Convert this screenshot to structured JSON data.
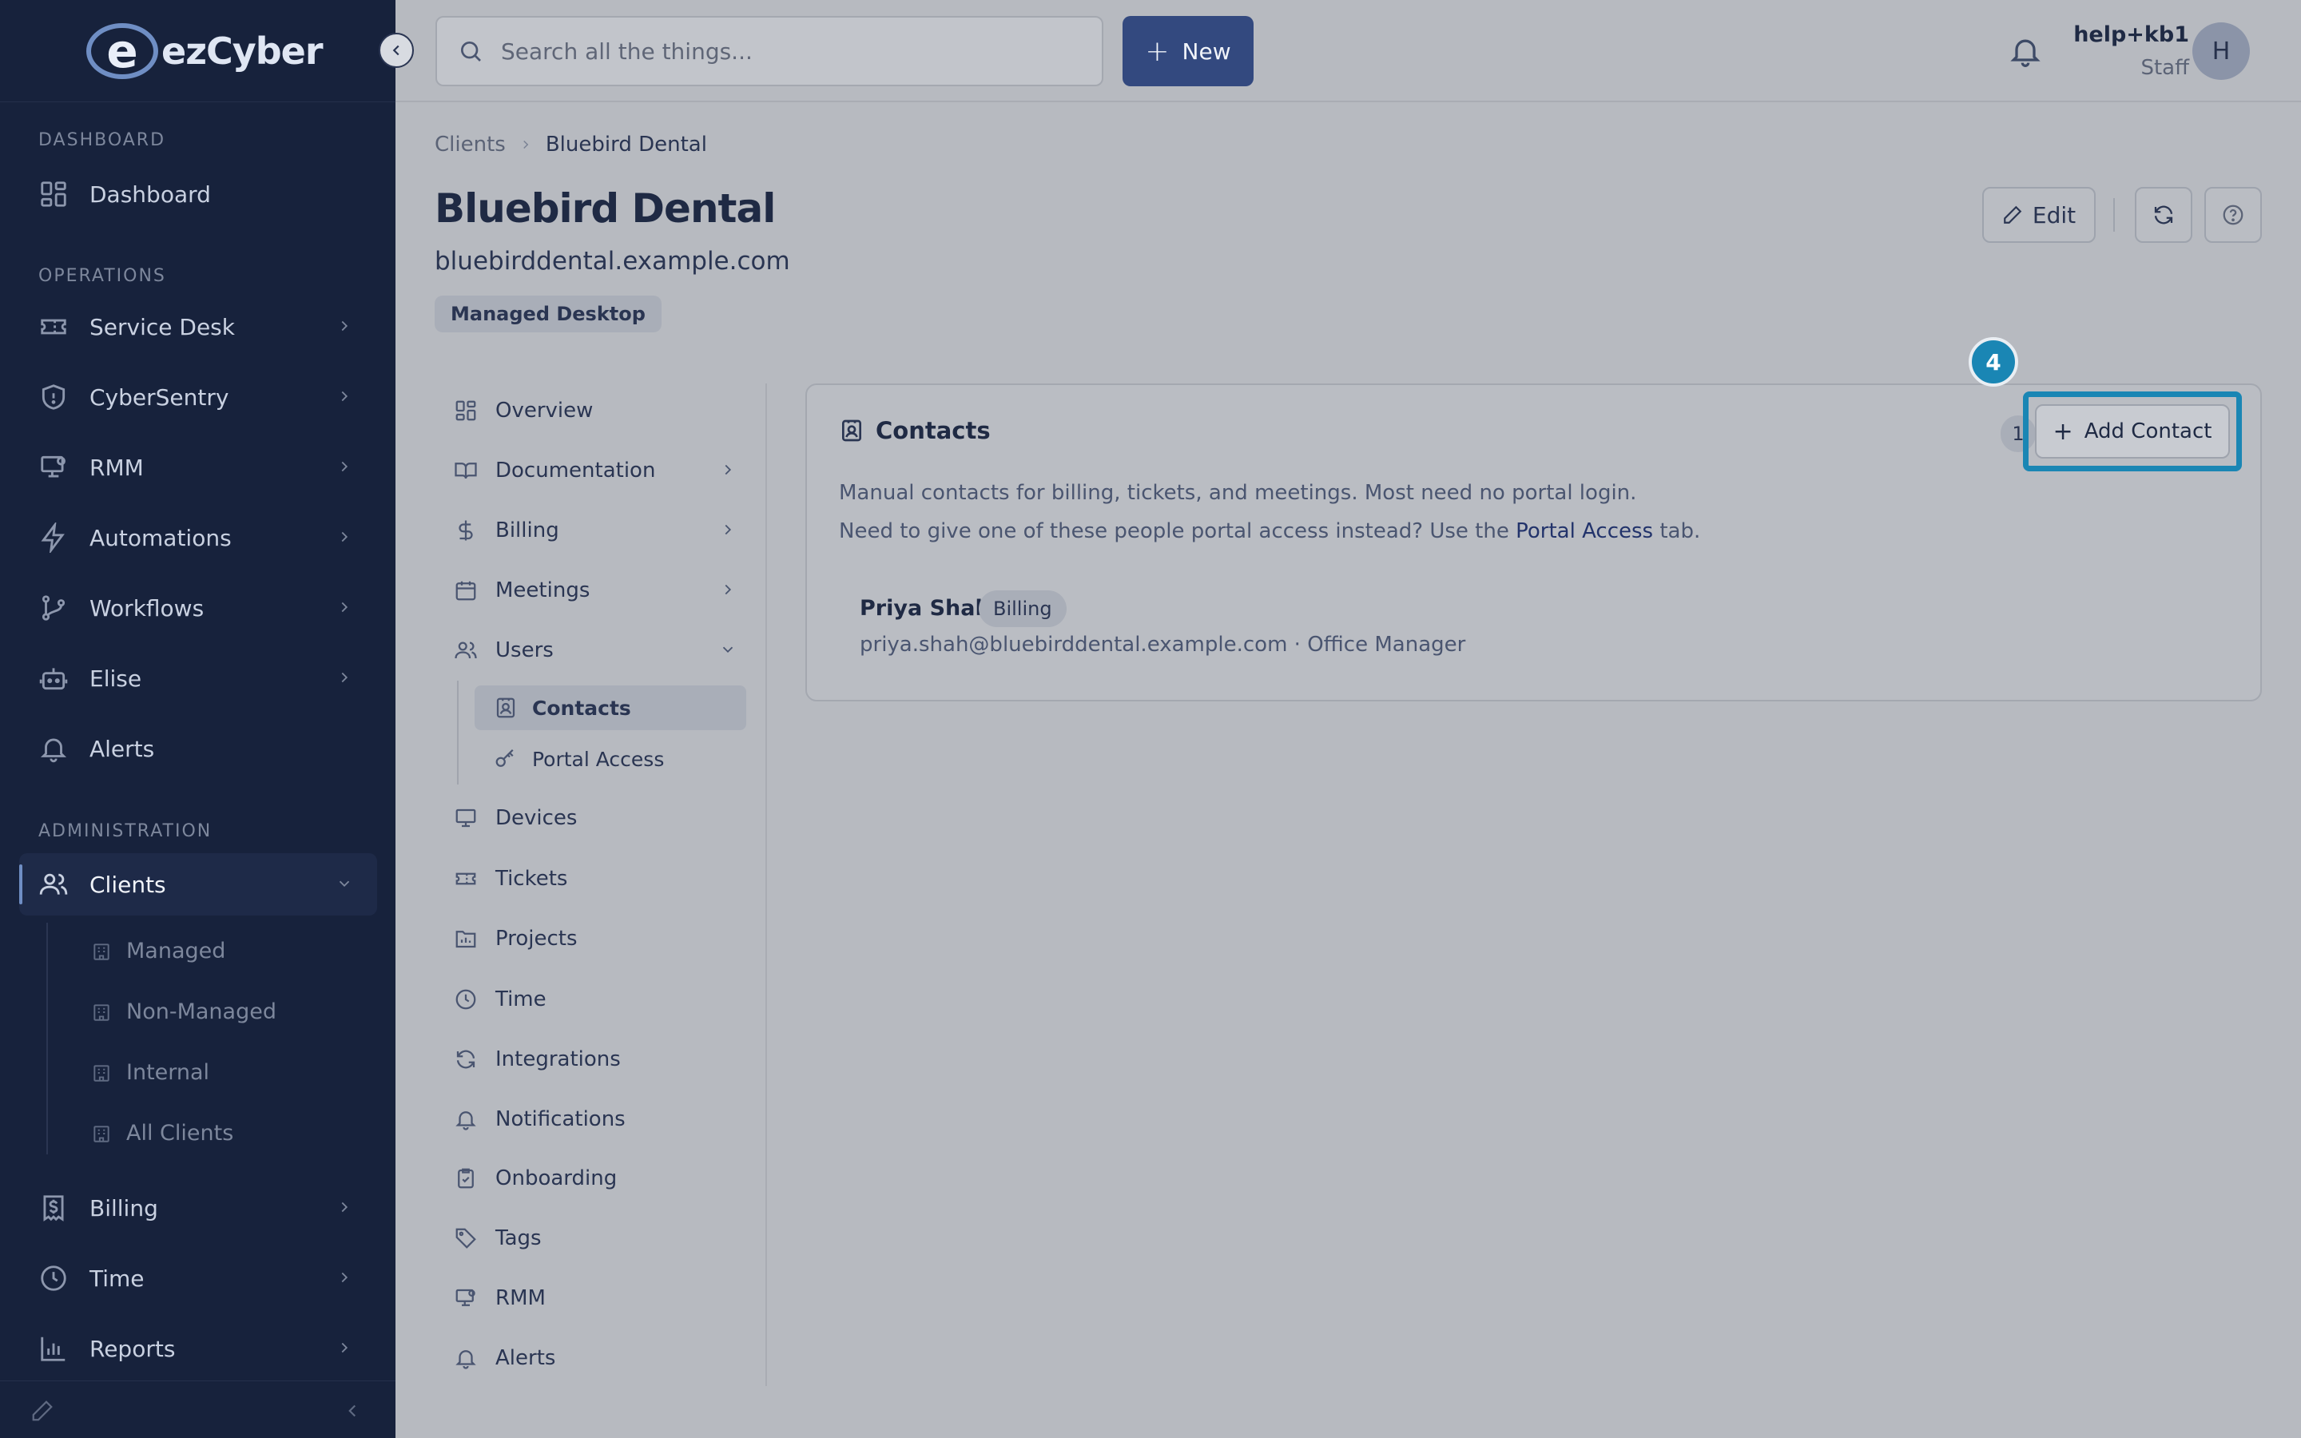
{
  "brand": {
    "logo_letter": "e",
    "name": "ezCyber"
  },
  "sidebar": {
    "sections": {
      "dashboard": "DASHBOARD",
      "operations": "OPERATIONS",
      "administration": "ADMINISTRATION"
    },
    "items": {
      "dashboard": "Dashboard",
      "service_desk": "Service Desk",
      "cybersentry": "CyberSentry",
      "rmm": "RMM",
      "automations": "Automations",
      "workflows": "Workflows",
      "elise": "Elise",
      "alerts": "Alerts",
      "clients": "Clients",
      "billing": "Billing",
      "time": "Time",
      "reports": "Reports"
    },
    "clients_sub": [
      "Managed",
      "Non-Managed",
      "Internal",
      "All Clients"
    ]
  },
  "topbar": {
    "search_placeholder": "Search all the things...",
    "new_label": "New",
    "user_name": "help+kb1",
    "user_role": "Staff",
    "avatar_initial": "H"
  },
  "header": {
    "breadcrumb": [
      "Clients",
      "Bluebird Dental"
    ],
    "title": "Bluebird Dental",
    "domain": "bluebirddental.example.com",
    "badge": "Managed Desktop",
    "edit_label": "Edit"
  },
  "subnav": {
    "overview": "Overview",
    "documentation": "Documentation",
    "billing": "Billing",
    "meetings": "Meetings",
    "users": "Users",
    "contacts": "Contacts",
    "portal_access": "Portal Access",
    "devices": "Devices",
    "tickets": "Tickets",
    "projects": "Projects",
    "time": "Time",
    "integrations": "Integrations",
    "notifications": "Notifications",
    "onboarding": "Onboarding",
    "tags": "Tags",
    "rmm": "RMM",
    "alerts": "Alerts"
  },
  "contacts_card": {
    "title": "Contacts",
    "count": "1",
    "add_label": "Add Contact",
    "desc_line1": "Manual contacts for billing, tickets, and meetings. Most need no portal login.",
    "desc_line2_pre": "Need to give one of these people portal access instead? Use the ",
    "desc_line2_link": "Portal Access",
    "desc_line2_post": " tab.",
    "contacts": [
      {
        "name": "Priya Shah",
        "tag": "Billing",
        "meta": "priya.shah@bluebirddental.example.com · Office Manager"
      }
    ]
  },
  "tutorial_step": "4",
  "colors": {
    "sidebar_bg": "#17223c",
    "accent": "#33497f",
    "highlight": "#1a86b4"
  }
}
